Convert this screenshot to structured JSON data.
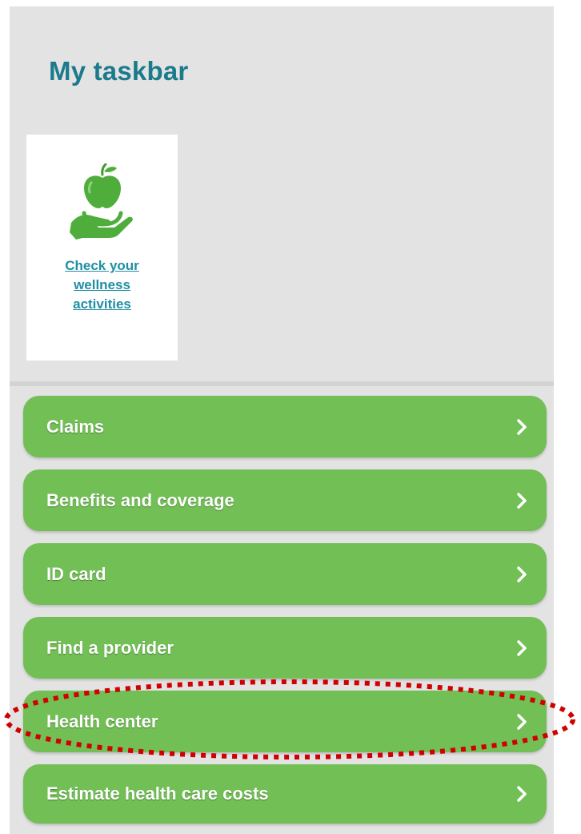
{
  "taskbar": {
    "title": "My taskbar",
    "tile": {
      "icon": "apple-in-hand-icon",
      "link_text": "Check your\nwellness\nactivities"
    }
  },
  "nav": {
    "items": [
      {
        "label": "Claims"
      },
      {
        "label": "Benefits and coverage"
      },
      {
        "label": "ID card"
      },
      {
        "label": "Find a provider"
      },
      {
        "label": "Health center"
      },
      {
        "label": "Estimate health care costs"
      }
    ],
    "highlighted_item": "Health center"
  },
  "colors": {
    "title": "#1b7a8c",
    "link": "#1f8fa3",
    "nav_button": "#72bf55",
    "icon_green": "#4fae3b",
    "highlight_dots": "#d00000",
    "panel_background": "#e3e3e3"
  }
}
